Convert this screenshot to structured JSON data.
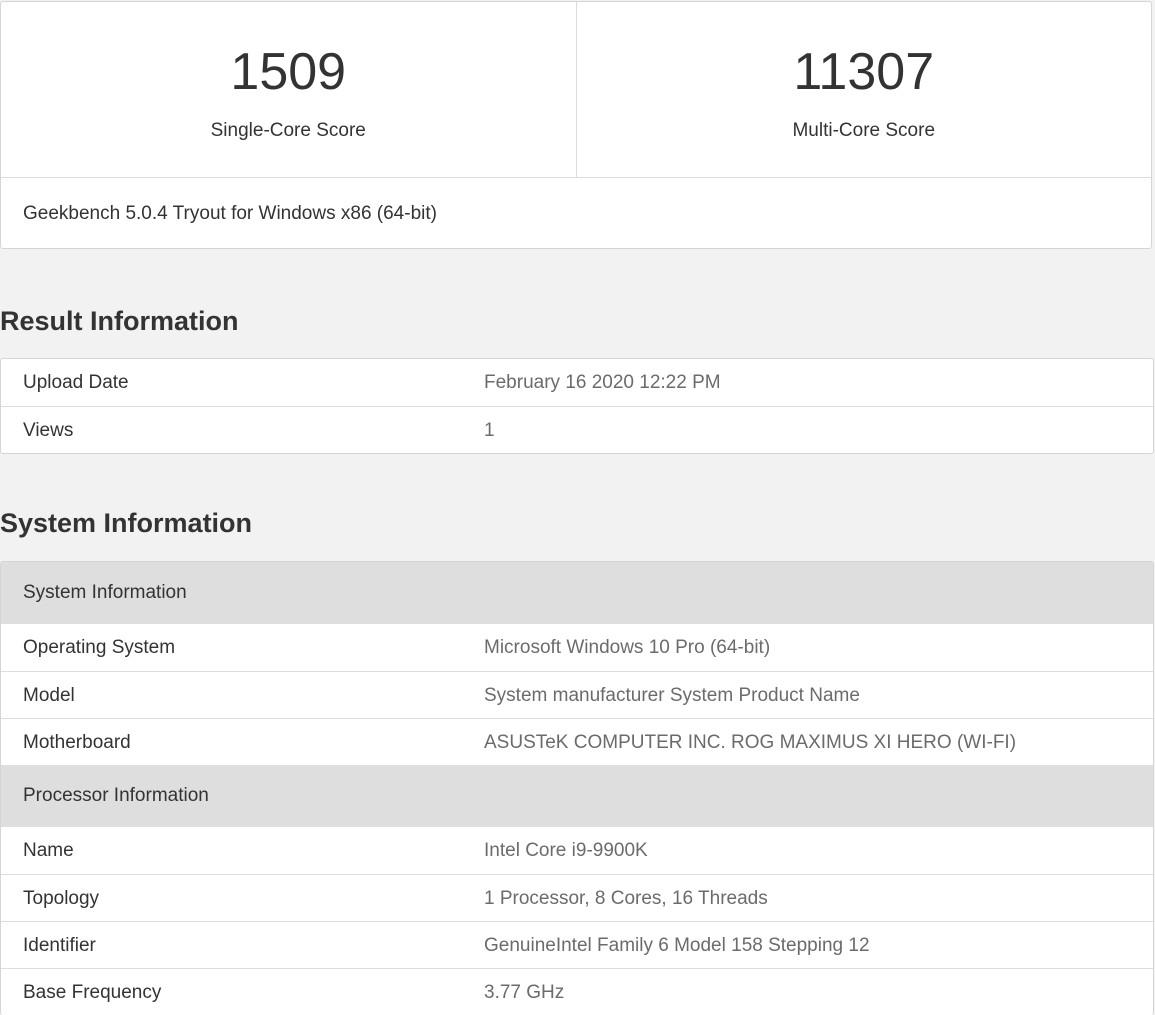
{
  "scores": {
    "single": {
      "value": "1509",
      "label": "Single-Core Score"
    },
    "multi": {
      "value": "11307",
      "label": "Multi-Core Score"
    },
    "version": "Geekbench 5.0.4 Tryout for Windows x86 (64-bit)"
  },
  "result_info": {
    "heading": "Result Information",
    "rows": [
      {
        "name": "Upload Date",
        "value": "February 16 2020 12:22 PM"
      },
      {
        "name": "Views",
        "value": "1"
      }
    ]
  },
  "system_info": {
    "heading": "System Information",
    "groups": [
      {
        "title": "System Information",
        "rows": [
          {
            "name": "Operating System",
            "value": "Microsoft Windows 10 Pro (64-bit)"
          },
          {
            "name": "Model",
            "value": "System manufacturer System Product Name"
          },
          {
            "name": "Motherboard",
            "value": "ASUSTeK COMPUTER INC. ROG MAXIMUS XI HERO (WI-FI)"
          }
        ]
      },
      {
        "title": "Processor Information",
        "rows": [
          {
            "name": "Name",
            "value": "Intel Core i9-9900K"
          },
          {
            "name": "Topology",
            "value": "1 Processor, 8 Cores, 16 Threads"
          },
          {
            "name": "Identifier",
            "value": "GenuineIntel Family 6 Model 158 Stepping 12"
          },
          {
            "name": "Base Frequency",
            "value": "3.77 GHz"
          }
        ]
      }
    ]
  },
  "colors": {
    "page_background": "#f2f2f2",
    "card_background": "#ffffff",
    "group_header_background": "#dedede",
    "value_text": "#6b6b6b",
    "label_text": "#333333"
  }
}
